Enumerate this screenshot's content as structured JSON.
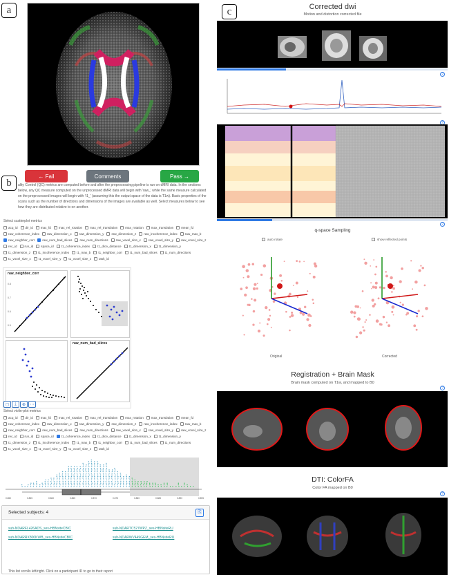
{
  "panel_letters": {
    "a": "a",
    "b": "b",
    "c": "c"
  },
  "qc": {
    "fail_label": "← Fail",
    "comments_label": "Comments",
    "pass_label": "Pass →"
  },
  "description": "ality Control (QC) metrics are computed before and after the preprocessing pipeline is run on dMRI data. In the sections below, any QC measure computed on the unprocessed dMRI data will begin with 'raw_' while the same measure calculated on the preprocessed images will begin with 't1_' (assuming this the output space of the data is T1w). Basic properties of the scans such as the number of directions and dimensions of the images are available as well. Select measures below to see how they are distributed relative to on another.",
  "scatter_label": "Select scatterplot metrics",
  "violin_label": "Select violin-plot metrics",
  "metrics": [
    {
      "name": "acq_id"
    },
    {
      "name": "dir_id"
    },
    {
      "name": "max_fd"
    },
    {
      "name": "max_rel_rotation"
    },
    {
      "name": "max_rel_translation"
    },
    {
      "name": "max_rotation"
    },
    {
      "name": "max_translation"
    },
    {
      "name": "mean_fd"
    },
    {
      "name": "raw_coherence_index"
    },
    {
      "name": "raw_dimension_x"
    },
    {
      "name": "raw_dimension_y"
    },
    {
      "name": "raw_dimension_z"
    },
    {
      "name": "raw_incoherence_index"
    },
    {
      "name": "raw_max_b"
    },
    {
      "name": "raw_neighbor_corr"
    },
    {
      "name": "raw_num_bad_slices"
    },
    {
      "name": "raw_num_directions"
    },
    {
      "name": "raw_voxel_size_x"
    },
    {
      "name": "raw_voxel_size_y"
    },
    {
      "name": "raw_voxel_size_z"
    },
    {
      "name": "rec_id"
    },
    {
      "name": "run_id"
    },
    {
      "name": "space_id"
    },
    {
      "name": "t1_coherence_index"
    },
    {
      "name": "t1_dice_distance"
    },
    {
      "name": "t1_dimension_x"
    },
    {
      "name": "t1_dimension_y"
    },
    {
      "name": "t1_dimension_z"
    },
    {
      "name": "t1_incoherence_index"
    },
    {
      "name": "t1_max_b"
    },
    {
      "name": "t1_neighbor_corr"
    },
    {
      "name": "t1_num_bad_slices"
    },
    {
      "name": "t1_num_directions"
    },
    {
      "name": "t1_voxel_size_x"
    },
    {
      "name": "t1_voxel_size_y"
    },
    {
      "name": "t1_voxel_size_z"
    },
    {
      "name": "task_id"
    }
  ],
  "scatter_checked": [
    "raw_neighbor_corr",
    "raw_num_bad_slices"
  ],
  "violin_checked": [
    "t1_coherence_index"
  ],
  "splom": {
    "title_a": "raw_neighbor_corr",
    "title_b": "raw_num_bad_slices",
    "ticks_x_bottom": [
      "0.5",
      "0.6",
      "0.7",
      "0.8"
    ],
    "ticks_x_bottom_b": [
      "0",
      "100",
      "200",
      "300",
      "400",
      "500"
    ]
  },
  "splom_tools": [
    "▢",
    "⤓",
    "⊕",
    "⋯"
  ],
  "violin_ticks": [
    "0.850",
    "0.855",
    "0.860",
    "0.865",
    "0.870",
    "0.875",
    "0.880",
    "0.885",
    "0.890",
    "0.895"
  ],
  "selected": {
    "title": "Selected subjects: 4",
    "subjects": [
      "sub-NDARFL426ADS_ses-HBNsiteCBIC",
      "sub-NDARTC527WPZ_ses-HBNsiteRU",
      "sub-NDARRX800KWB_ses-HBNsiteCBIC",
      "sub-NDARWV449GEM_ses-HBNsiteRU"
    ],
    "note": "This list scrolls left/right. Click on a participant ID to go to their report"
  },
  "panel_c": {
    "title": "Corrected dwi",
    "subtitle": "Motion and distortion corrected file",
    "qspace_title": "q-space Sampling",
    "auto_rotate": "auto rotate",
    "show_reflected": "show reflected points",
    "original": "Original",
    "corrected": "Corrected",
    "reg_title": "Registration + Brain Mask",
    "reg_subtitle": "Brain mask computed on T1w, and mapped to B0",
    "dti_title": "DTI: ColorFA",
    "dti_subtitle": "Color FA mapped on B0",
    "help": "?"
  },
  "colors": {
    "fail": "#d9343a",
    "comments": "#6c757d",
    "pass": "#28a745",
    "accent": "#2f7ae5",
    "link": "#1b8f8f"
  }
}
